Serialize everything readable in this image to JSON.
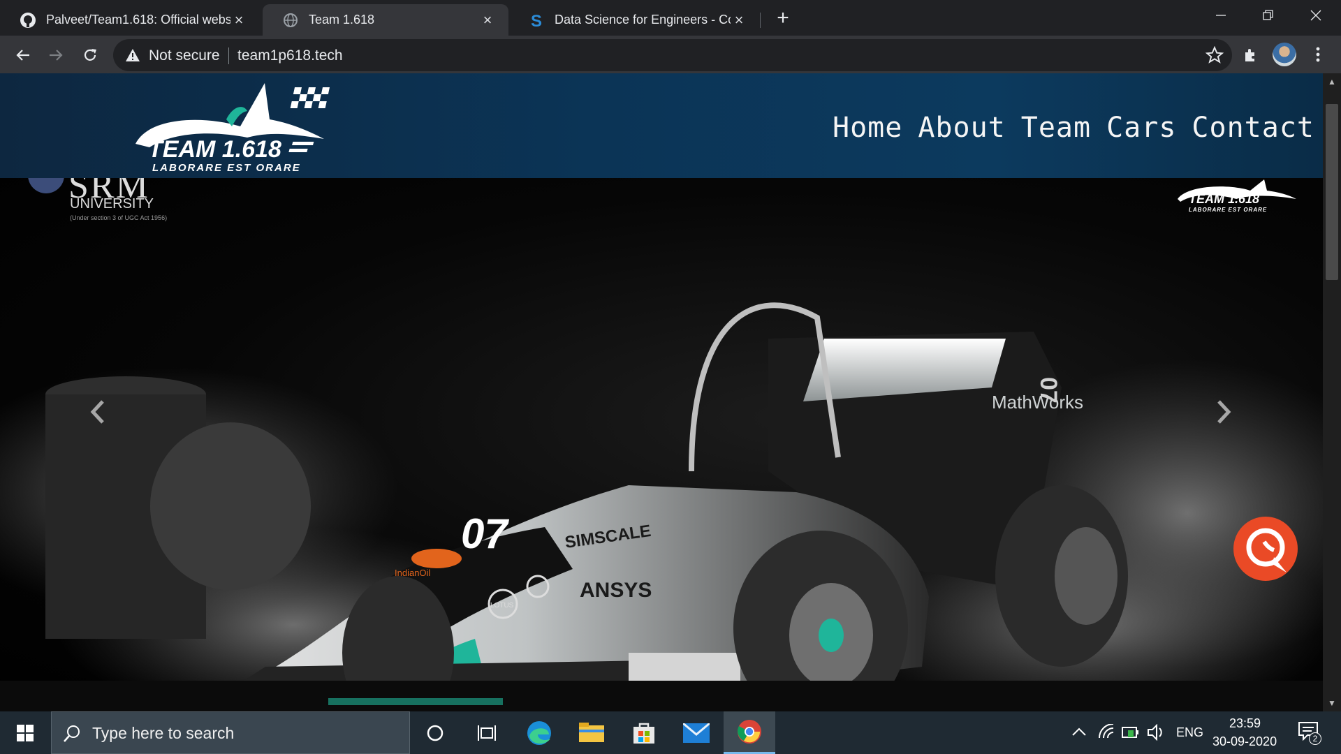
{
  "browser": {
    "tabs": [
      {
        "title": "Palveet/Team1.618: Official websi",
        "favicon": "github-icon",
        "active": false
      },
      {
        "title": "Team 1.618",
        "favicon": "globe-icon",
        "active": true
      },
      {
        "title": "Data Science for Engineers - Cou",
        "favicon": "s-icon",
        "active": false
      }
    ],
    "security_label": "Not secure",
    "url": "team1p618.tech"
  },
  "site": {
    "logo_text": "TEAM 1.618",
    "logo_tagline": "LABORARE  EST  ORARE",
    "nav": [
      "Home",
      "About",
      "Team",
      "Cars",
      "Contact"
    ]
  },
  "hero": {
    "university_name": "SRM",
    "university_label": "UNIVERSITY",
    "university_sub": "(Under section 3 of UGC Act 1956)",
    "car_number": "07",
    "car_sponsors": [
      "SIMSCALE",
      "ANSYS",
      "MathWorks",
      "IndianOil",
      "LOTUS"
    ],
    "watermark": "TEAM 1.618",
    "watermark_tagline": "LABORARE EST ORARE",
    "prev_icon": "chevron-left-icon",
    "next_icon": "chevron-right-icon"
  },
  "taskbar": {
    "search_placeholder": "Type here to search",
    "language": "ENG",
    "time": "23:59",
    "date": "30-09-2020",
    "notification_count": "2"
  },
  "colors": {
    "header_gradient_start": "#0d2740",
    "header_gradient_end": "#0c3a5e",
    "chat_button": "#ea4a26",
    "accent_teal": "#1fb59a"
  }
}
